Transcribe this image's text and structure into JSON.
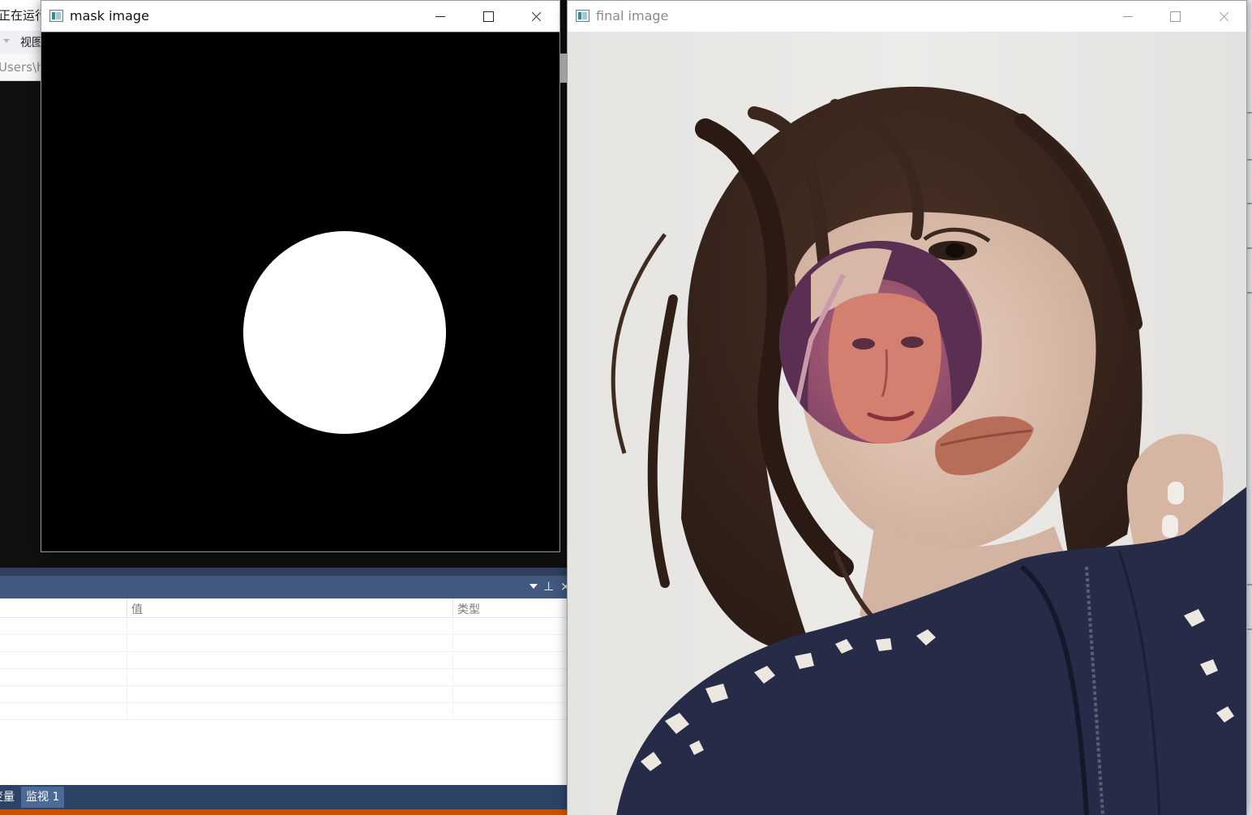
{
  "ide": {
    "title_fragment": "正在运行",
    "menu_fragment": "视图",
    "path_fragment": "Users\\h",
    "watch_panel": {
      "columns": {
        "name": "",
        "value": "值",
        "type": "类型"
      },
      "rows": [
        {
          "name": "",
          "value": "",
          "type": ""
        },
        {
          "name": "",
          "value": "",
          "type": ""
        },
        {
          "name": "",
          "value": "",
          "type": ""
        },
        {
          "name": "",
          "value": "",
          "type": ""
        },
        {
          "name": "",
          "value": "",
          "type": ""
        },
        {
          "name": "",
          "value": "",
          "type": ""
        }
      ]
    },
    "bottom_tabs": [
      {
        "label": "变量"
      },
      {
        "label": "监视 1"
      }
    ],
    "accent_colors": {
      "panel_header": "#41597e",
      "tabs_bar": "#2d4366",
      "status_bar": "#ca5100"
    }
  },
  "windows": {
    "mask": {
      "title": "mask image",
      "state": "active",
      "content": "black background with white filled circle"
    },
    "final": {
      "title": "final image",
      "state": "inactive",
      "content": "photo of dark-haired woman with circular inset of another face"
    }
  }
}
